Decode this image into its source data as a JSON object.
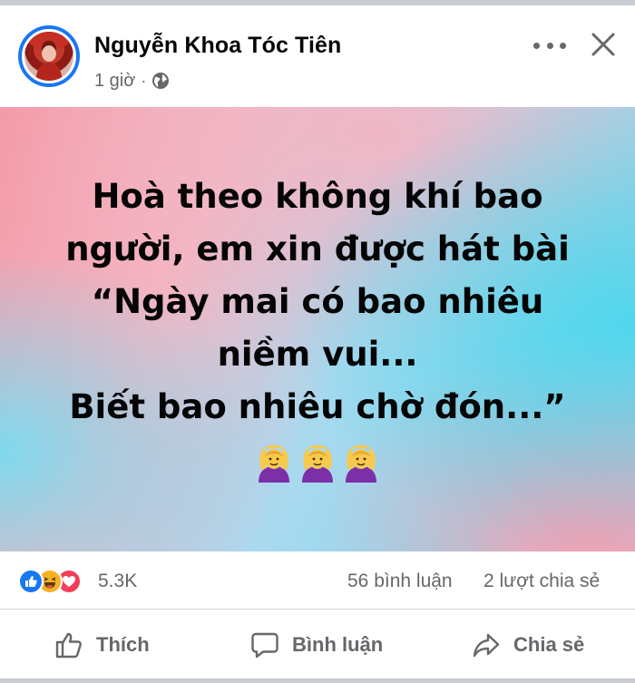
{
  "post": {
    "author": "Nguyễn Khoa Tóc Tiên",
    "time": "1 giờ",
    "separator": "·",
    "text_lines": [
      "Hoà theo không khí bao",
      "người, em xin được hát bài",
      "“Ngày mai có bao nhiêu",
      "niềm vui...",
      "Biết bao nhiêu chờ đón...”"
    ],
    "emojis": [
      "person-gesturing-ok",
      "person-gesturing-ok",
      "person-gesturing-ok"
    ]
  },
  "reactions": {
    "icons": [
      "like",
      "haha",
      "love"
    ],
    "count": "5.3K",
    "comments": "56 bình luận",
    "shares": "2 lượt chia sẻ"
  },
  "actions": {
    "like_label": "Thích",
    "comment_label": "Bình luận",
    "share_label": "Chia sẻ"
  },
  "colors": {
    "like_blue": "#1877f2",
    "haha_yellow": "#f7b125",
    "love_red": "#f33e58",
    "secondary_text": "#65676b"
  }
}
